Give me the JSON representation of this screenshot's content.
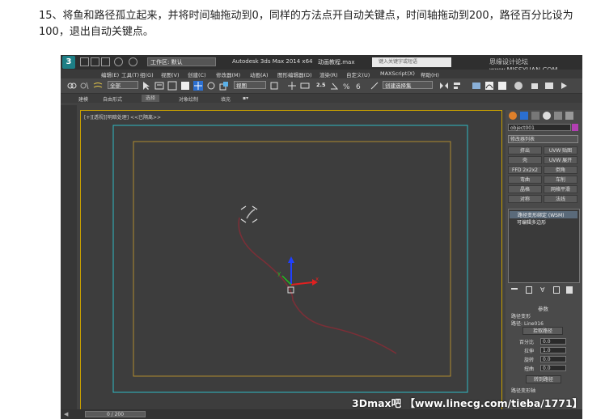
{
  "caption": "15、将鱼和路径孤立起来，并将时间轴拖动到0，同样的方法点开自动关键点，时间轴拖动到200，路径百分比设为100，退出自动关键点。",
  "app": {
    "title": "Autodesk 3ds Max  2014 x64",
    "file": "动画教程.max",
    "workspace": "工作区: 默认",
    "search_placeholder": "键入关键字或短语",
    "watermark_top": "思缘设计论坛 www.MISSYUAN.COM",
    "menu": [
      "编辑(E)",
      "工具(T)",
      "组(G)",
      "视图(V)",
      "创建(C)",
      "修改器(M)",
      "动画(A)",
      "图形编辑器(D)",
      "渲染(R)",
      "自定义(U)",
      "MAXScript(X)",
      "帮助(H)"
    ],
    "toolbar": {
      "selection_filter": "全部",
      "ref_coord": "视图",
      "snap_value": "2.5",
      "named_sel": "创建选择集"
    },
    "ribbon": [
      "建模",
      "自由形式",
      "选择",
      "对象绘制",
      "填充"
    ],
    "ribbon_active": "选择",
    "viewport_label": "[+][透视][明暗处理]  <<已隔离>>",
    "panel": {
      "object_name": "object001",
      "modifier_list": "修改器列表",
      "buttons": [
        [
          "挤出",
          "UVW 贴图"
        ],
        [
          "壳",
          "UVW 展开"
        ],
        [
          "FFD 2x2x2",
          "倒角"
        ],
        [
          "弯曲",
          "车削"
        ],
        [
          "晶格",
          "网格平滑"
        ],
        [
          "对称",
          "法线"
        ]
      ],
      "stack": [
        "路径变形绑定 (WSM)",
        "可编辑多边形"
      ],
      "params_title": "参数",
      "path_deform": "路径变形",
      "path_label": "路径:",
      "path_value": "Line016",
      "pick_path": "拾取路径",
      "fields": [
        {
          "label": "百分比",
          "value": "0.0"
        },
        {
          "label": "拉伸",
          "value": "1.0"
        },
        {
          "label": "旋转",
          "value": "0.0"
        },
        {
          "label": "扭曲",
          "value": "0.0"
        }
      ],
      "transfer": "转到路径",
      "path_axis": "路径变形轴"
    },
    "time_slider": "0 / 200",
    "footer_watermark": "3Dmax吧 【www.linecg.com/tieba/1771】",
    "colors": {
      "viewport_border": "#c8a000",
      "safe_frame": "#2fb9c2",
      "inner_frame": "#b08a2e",
      "path": "#7a2f37",
      "gizmo_x": "#e02020",
      "gizmo_y": "#20c020",
      "gizmo_z": "#2040ff",
      "bg": "#424242"
    }
  }
}
